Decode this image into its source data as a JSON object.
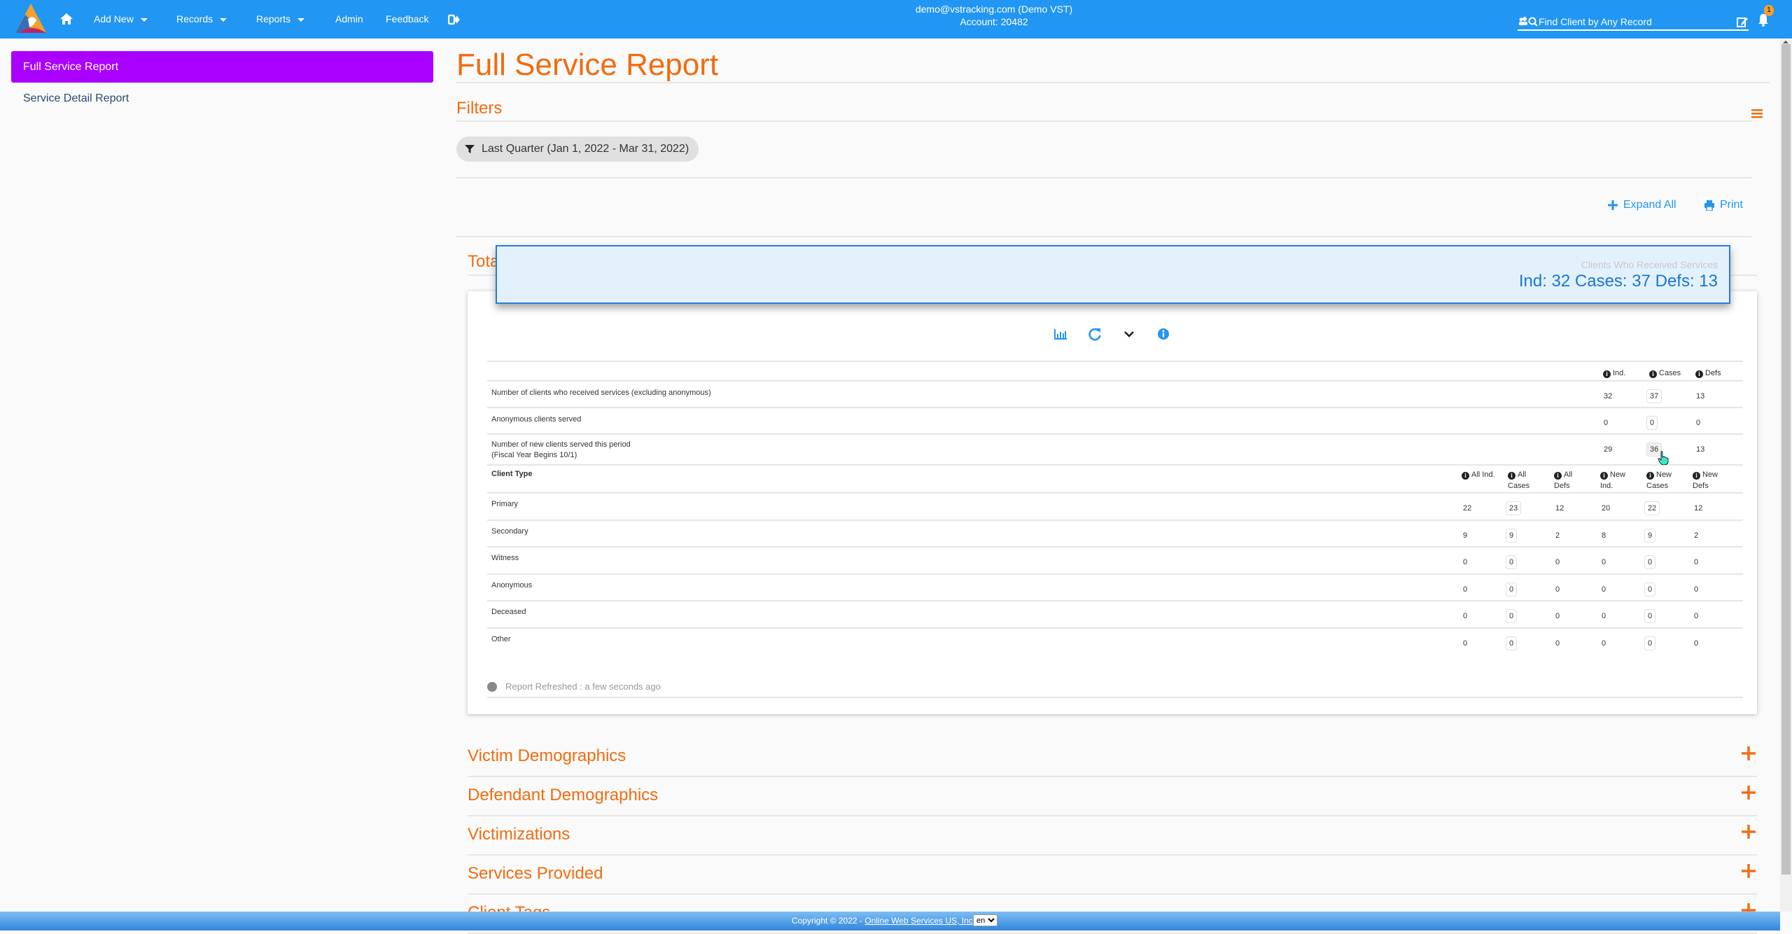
{
  "header": {
    "nav": [
      {
        "label": "Add New",
        "dropdown": true
      },
      {
        "label": "Records",
        "dropdown": true
      },
      {
        "label": "Reports",
        "dropdown": true
      },
      {
        "label": "Admin",
        "dropdown": false
      },
      {
        "label": "Feedback",
        "dropdown": false
      }
    ],
    "user_email": "demo@vstracking.com (Demo VST)",
    "account": "Account: 20482",
    "search_placeholder": "Find Client by Any Record",
    "notification_count": "1"
  },
  "sidebar": {
    "items": [
      {
        "label": "Full Service Report",
        "active": true
      },
      {
        "label": "Service Detail Report",
        "active": false
      }
    ]
  },
  "main": {
    "title": "Full Service Report",
    "filters_heading": "Filters",
    "filter_chip": "Last Quarter (Jan 1, 2022 - Mar 31, 2022)",
    "expand_all": "Expand All",
    "print": "Print",
    "totals_heading": "Totals"
  },
  "popup": {
    "subtitle": "Clients Who Received Services",
    "value": "Ind: 32 Cases: 37 Defs: 13"
  },
  "summary_table": {
    "headers": [
      "Ind.",
      "Cases",
      "Defs"
    ],
    "rows": [
      {
        "label": "Number of clients who received services (excluding anonymous)",
        "label2": "",
        "ind": "32",
        "cases": "37",
        "defs": "13"
      },
      {
        "label": "Anonymous clients served",
        "label2": "",
        "ind": "0",
        "cases": "0",
        "defs": "0"
      },
      {
        "label": "Number of new clients served this period",
        "label2": "(Fiscal Year Begins 10/1)",
        "ind": "29",
        "cases": "36",
        "defs": "13"
      }
    ]
  },
  "client_type_table": {
    "title": "Client Type",
    "headers": [
      {
        "l1": "All Ind.",
        "l2": ""
      },
      {
        "l1": "All",
        "l2": "Cases"
      },
      {
        "l1": "All",
        "l2": "Defs"
      },
      {
        "l1": "New",
        "l2": "Ind."
      },
      {
        "l1": "New",
        "l2": "Cases"
      },
      {
        "l1": "New",
        "l2": "Defs"
      }
    ],
    "rows": [
      {
        "label": "Primary",
        "values": [
          "22",
          "23",
          "12",
          "20",
          "22",
          "12"
        ]
      },
      {
        "label": "Secondary",
        "values": [
          "9",
          "9",
          "2",
          "8",
          "9",
          "2"
        ]
      },
      {
        "label": "Witness",
        "values": [
          "0",
          "0",
          "0",
          "0",
          "0",
          "0"
        ]
      },
      {
        "label": "Anonymous",
        "values": [
          "0",
          "0",
          "0",
          "0",
          "0",
          "0"
        ]
      },
      {
        "label": "Deceased",
        "values": [
          "0",
          "0",
          "0",
          "0",
          "0",
          "0"
        ]
      },
      {
        "label": "Other",
        "values": [
          "0",
          "0",
          "0",
          "0",
          "0",
          "0"
        ]
      }
    ]
  },
  "report_refreshed": "Report Refreshed : a few seconds ago",
  "sections": [
    "Victim Demographics",
    "Defendant Demographics",
    "Victimizations",
    "Services Provided",
    "Client Tags"
  ],
  "footer": {
    "copyright": "Copyright © 2022 - ",
    "company": "Online Web Services US, Inc.",
    "language": "en"
  },
  "colors": {
    "header_bg": "#2196F3",
    "accent_orange": "#F26B0F",
    "sidebar_active": "#AA00FF",
    "link_blue": "#2196F3"
  }
}
